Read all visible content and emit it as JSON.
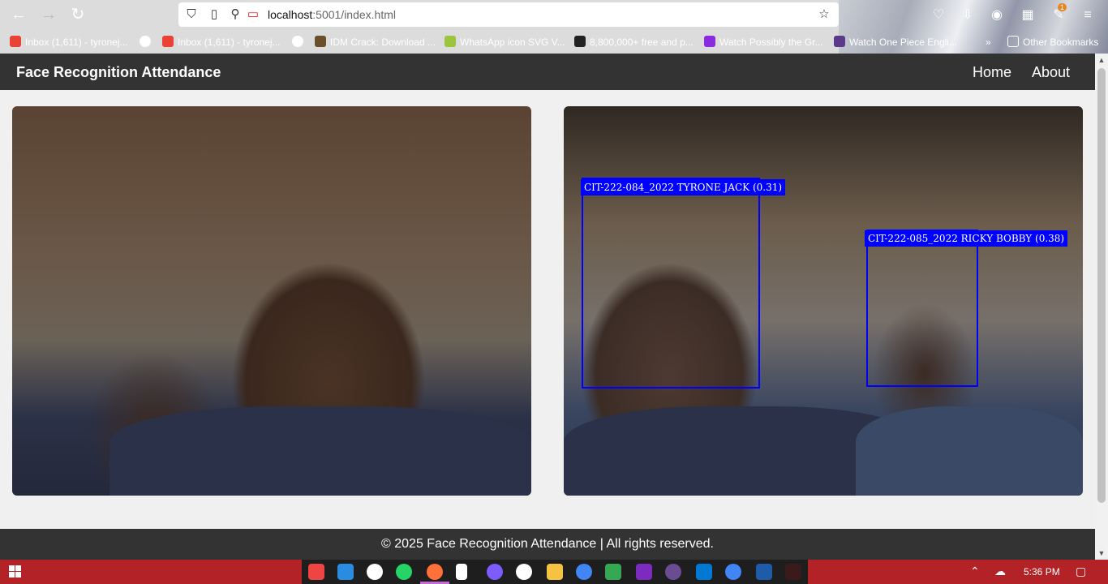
{
  "browser": {
    "url_host": "localhost",
    "url_path": ":5001/index.html",
    "bookmarks": [
      {
        "label": "Inbox (1,611) - tyronej...",
        "color": "#ea4335"
      },
      {
        "label": "Inbox (1,611) - tyronej...",
        "color": "#ea4335"
      },
      {
        "label": "IDM Crack: Download ...",
        "color": "#6b4f2a"
      },
      {
        "label": "WhatsApp icon SVG V...",
        "color": "#9bc53d"
      },
      {
        "label": "8,800,000+ free and p...",
        "color": "#222222"
      },
      {
        "label": "Watch Possibly the Gr...",
        "color": "#8a2be2"
      },
      {
        "label": "Watch One Piece Engli...",
        "color": "#5b3a8a"
      },
      {
        "label": "Other Bookmarks",
        "color": "#ffffff"
      }
    ],
    "downloads_badge": "1"
  },
  "app": {
    "title": "Face Recognition Attendance",
    "nav": {
      "home": "Home",
      "about": "About"
    },
    "detections": [
      {
        "label": "CIT-222-084_2022 TYRONE JACK (0.31)"
      },
      {
        "label": "CIT-222-085_2022 RICKY BOBBY (0.38)"
      }
    ],
    "footer": "© 2025 Face Recognition Attendance | All rights reserved."
  },
  "taskbar": {
    "time": "5:36 PM"
  }
}
